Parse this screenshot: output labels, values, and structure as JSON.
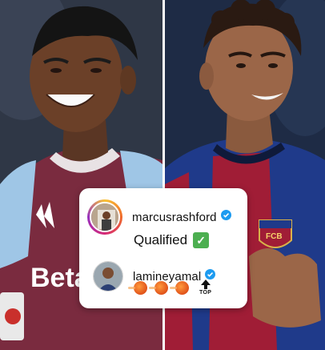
{
  "post": {
    "comments": [
      {
        "username": "marcusrashford",
        "verified": true,
        "text": "Qualified",
        "emoji": "white-heavy-check-mark"
      },
      {
        "username": "lamineyamal",
        "verified": true,
        "emoji": [
          "comet-football",
          "comet-football",
          "comet-football",
          "top-arrow"
        ],
        "top_label": "TOP"
      }
    ]
  },
  "jerseys": {
    "left_sponsor": "Betan",
    "right_crest": "FCB"
  },
  "colors": {
    "villa_claret": "#7a2b3f",
    "villa_blue": "#9fc6e6",
    "barca_blue": "#1f3a8a",
    "barca_red": "#a01d36",
    "verified_blue": "#1d9bf0",
    "check_green": "#4caf50"
  }
}
